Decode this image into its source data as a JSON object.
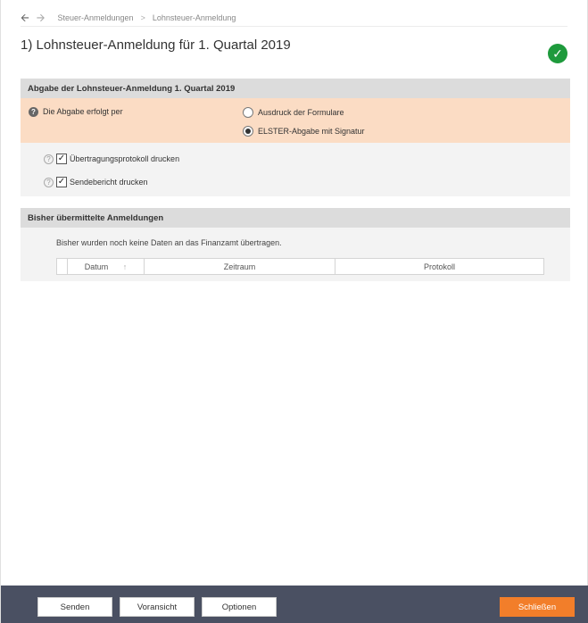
{
  "nav": {
    "back_icon": "arrow-left-icon",
    "forward_icon": "arrow-right-icon",
    "breadcrumb": [
      "Steuer-Anmeldungen",
      "Lohnsteuer-Anmeldung"
    ],
    "separator": ">"
  },
  "page": {
    "title": "1) Lohnsteuer-Anmeldung für 1. Quartal 2019",
    "status_icon": "check-circle-icon",
    "status_color": "#1e9a3c"
  },
  "submission": {
    "header": "Abgabe der Lohnsteuer-Anmeldung 1. Quartal 2019",
    "method_label": "Die Abgabe erfolgt per",
    "options": [
      {
        "label": "Ausdruck der Formulare",
        "selected": false
      },
      {
        "label": "ELSTER-Abgabe mit Signatur",
        "selected": true
      }
    ],
    "checkboxes": [
      {
        "label": "Übertragungsprotokoll drucken",
        "checked": true
      },
      {
        "label": "Sendebericht drucken",
        "checked": true
      }
    ],
    "highlight_color": "#fbdcc4"
  },
  "history": {
    "header": "Bisher übermittelte Anmeldungen",
    "info": "Bisher wurden noch keine Daten an das Finanzamt übertragen.",
    "columns": [
      "Datum",
      "Zeitraum",
      "Protokoll"
    ],
    "rows": []
  },
  "footer": {
    "buttons": [
      "Senden",
      "Voransicht",
      "Optionen"
    ],
    "close": "Schließen",
    "bg_color": "#4a5062",
    "accent_color": "#f27e2a"
  }
}
